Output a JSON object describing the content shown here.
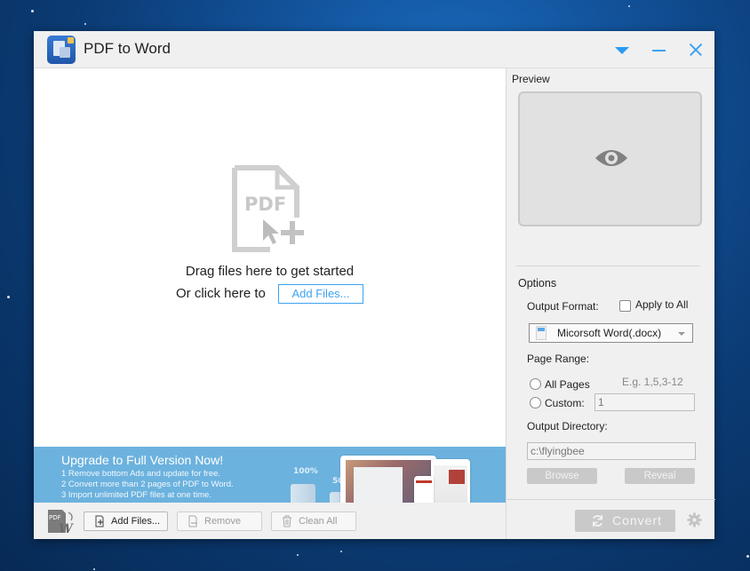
{
  "window": {
    "title": "PDF to Word",
    "accent_color": "#3ea3f1"
  },
  "titlebar": {
    "menu_icon": "dropdown-triangle-icon",
    "minimize_icon": "minimize-icon",
    "close_icon": "close-icon"
  },
  "drop_zone": {
    "icon": "pdf-add-file-icon",
    "drag_text": "Drag files here to get started",
    "click_text": "Or click here to",
    "add_files_link": "Add Files..."
  },
  "banner": {
    "title": "Upgrade to Full Version Now!",
    "lines": [
      "1 Remove bottom Ads and update for free.",
      "2 Convert more than 2 pages of PDF to Word.",
      "3 Import unlimited PDF files at one time."
    ],
    "pct_100": "100%",
    "pct_50": "50",
    "background_color": "#6cb2de"
  },
  "toolbar": {
    "add_files": "Add Files...",
    "remove": "Remove",
    "clean_all": "Clean All"
  },
  "preview": {
    "label": "Preview",
    "icon": "eye-icon"
  },
  "options": {
    "label": "Options",
    "output_format_label": "Output Format:",
    "apply_to_all": "Apply to All",
    "format_selected": "Micorsoft Word(.docx)",
    "page_range_label": "Page Range:",
    "all_pages": "All Pages",
    "custom": "Custom:",
    "hint": "E.g. 1,5,3-12",
    "custom_value": "1",
    "output_directory_label": "Output Directory:",
    "output_directory_value": "c:\\flyingbee",
    "browse": "Browse",
    "reveal": "Reveal"
  },
  "actions": {
    "convert": "Convert",
    "settings_icon": "gear-icon"
  }
}
